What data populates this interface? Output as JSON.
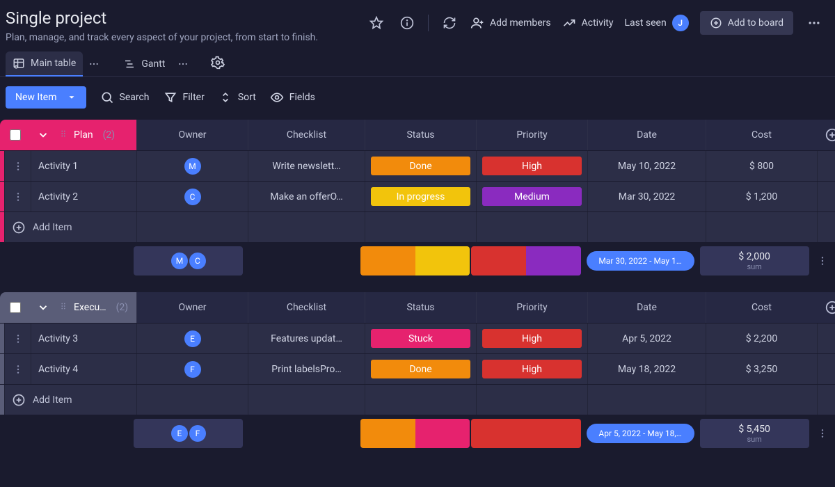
{
  "header": {
    "title": "Single project",
    "subtitle": "Plan, manage, and track every aspect of your project, from start to finish.",
    "add_members": "Add members",
    "activity": "Activity",
    "last_seen": "Last seen",
    "user_initial": "J",
    "add_to_board": "Add to board"
  },
  "tabs": {
    "main_table": "Main table",
    "gantt": "Gantt"
  },
  "toolbar": {
    "new_item": "New Item",
    "search": "Search",
    "filter": "Filter",
    "sort": "Sort",
    "fields": "Fields"
  },
  "columns": {
    "owner": "Owner",
    "checklist": "Checklist",
    "status": "Status",
    "priority": "Priority",
    "date": "Date",
    "cost": "Cost"
  },
  "groups": [
    {
      "name": "Plan",
      "count": "(2)",
      "accent": "#e6226e",
      "header_style": "gh-pink",
      "rows": [
        {
          "name": "Activity 1",
          "owner_initial": "M",
          "owner_color": "#4a7fff",
          "checklist": "Write newslett…",
          "status": {
            "label": "Done",
            "color": "#f28b0c"
          },
          "priority": {
            "label": "High",
            "color": "#d8322f"
          },
          "date": "May 10, 2022",
          "cost": "$ 800"
        },
        {
          "name": "Activity 2",
          "owner_initial": "C",
          "owner_color": "#4a7fff",
          "checklist": "Make an offerO…",
          "status": {
            "label": "In progress",
            "color": "#f2c40c"
          },
          "priority": {
            "label": "Medium",
            "color": "#8a2bbf"
          },
          "date": "Mar 30, 2022",
          "cost": "$ 1,200"
        }
      ],
      "add_item": "Add Item",
      "summary": {
        "owners": [
          "M",
          "C"
        ],
        "status_split": [
          {
            "color": "#f28b0c",
            "pct": 50
          },
          {
            "color": "#f2c40c",
            "pct": 50
          }
        ],
        "priority_split": [
          {
            "color": "#d8322f",
            "pct": 50
          },
          {
            "color": "#8a2bbf",
            "pct": 50
          }
        ],
        "date_range": "Mar 30, 2022 - May 1…",
        "cost_sum": "$ 2,000",
        "cost_label": "sum"
      }
    },
    {
      "name": "Execu…",
      "count": "(2)",
      "accent": "#5a5d78",
      "header_style": "gh-grey",
      "rows": [
        {
          "name": "Activity 3",
          "owner_initial": "E",
          "owner_color": "#4a7fff",
          "checklist": "Features updat…",
          "status": {
            "label": "Stuck",
            "color": "#e6226e"
          },
          "priority": {
            "label": "High",
            "color": "#d8322f"
          },
          "date": "Apr 5, 2022",
          "cost": "$ 2,200"
        },
        {
          "name": "Activity 4",
          "owner_initial": "F",
          "owner_color": "#4a7fff",
          "checklist": "Print labelsPro…",
          "status": {
            "label": "Done",
            "color": "#f28b0c"
          },
          "priority": {
            "label": "High",
            "color": "#d8322f"
          },
          "date": "May 18, 2022",
          "cost": "$ 3,250"
        }
      ],
      "add_item": "Add Item",
      "summary": {
        "owners": [
          "E",
          "F"
        ],
        "status_split": [
          {
            "color": "#f28b0c",
            "pct": 50
          },
          {
            "color": "#e6226e",
            "pct": 50
          }
        ],
        "priority_split": [
          {
            "color": "#d8322f",
            "pct": 100
          }
        ],
        "date_range": "Apr 5, 2022 - May 18,…",
        "cost_sum": "$ 5,450",
        "cost_label": "sum"
      }
    }
  ]
}
